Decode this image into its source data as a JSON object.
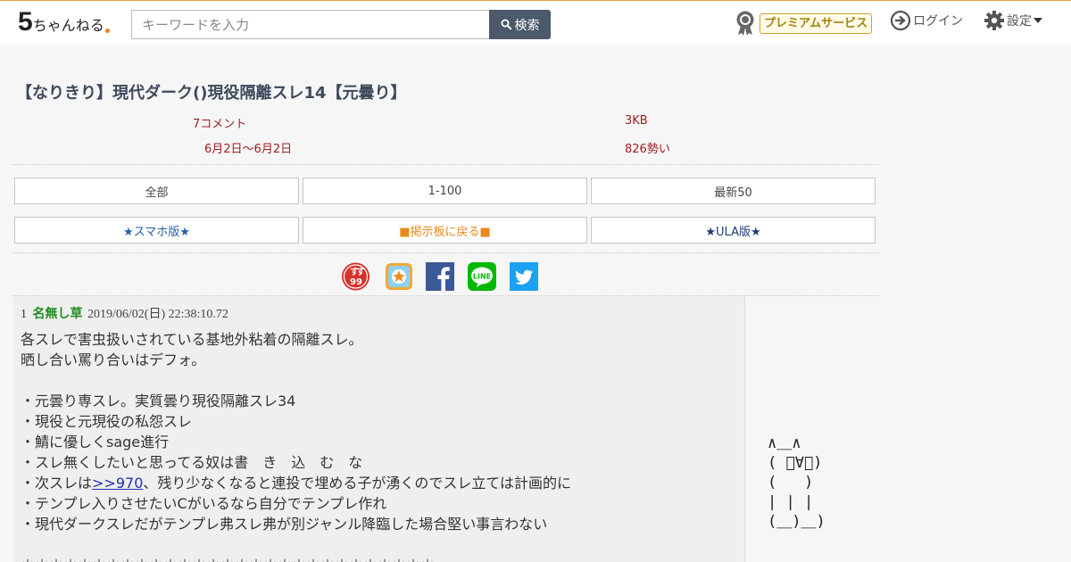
{
  "header": {
    "logo_five": "5",
    "logo_text": "ちゃんねる",
    "search": {
      "placeholder": "キーワードを入力",
      "button_label": "検索"
    },
    "premium_label": "プレミアムサービス",
    "login_label": "ログイン",
    "settings_label": "設定"
  },
  "thread": {
    "title": "【なりきり】現代ダーク()現役隔離スレ14【元曇り】",
    "comments": "7コメント",
    "size": "3KB",
    "date_range": "6月2日〜6月2日",
    "momentum": "826勢い"
  },
  "nav": {
    "all": "全部",
    "range": "1-100",
    "latest": "最新50",
    "smartphone": "★スマホ版★",
    "back_board": "■掲示板に戻る■",
    "ula": "★ULA版★"
  },
  "social": {
    "icons": [
      "sukusuku-icon",
      "app-icon",
      "facebook-icon",
      "line-icon",
      "twitter-icon"
    ],
    "line_label": "LINE"
  },
  "post": {
    "number": "1",
    "name": "名無し草",
    "datetime": "2019/06/02(日) 22:38:10.72",
    "lines": [
      "各スレで害虫扱いされている基地外粘着の隔離スレ。",
      "晒し合い罵り合いはデフォ。",
      "",
      "・元曇り専スレ。実質曇り現役隔離スレ34",
      "・現役と元現役の私怨スレ",
      "・鯖に優しくsage進行",
      "・スレ無くしたいと思ってる奴は書　き　込　む　な"
    ],
    "line_next_prefix": "・次スレは",
    "line_next_link": ">>970",
    "line_next_suffix": "、残り少なくなると連投で埋める子が湧くのでスレ立ては計画的に",
    "lines_after": [
      "・テンプレ入りさせたいCがいるなら自分でテンプレ作れ",
      "・現代ダークスレだがテンプレ弗スレ弗が別ジャンル降臨した場合堅い事言わない",
      "",
      "＊＊＊＊＊＊＊＊＊＊＊＊＊＊＊＊＊＊＊＊＊＊＊＊＊＊＊＊＊"
    ]
  },
  "ascii_art": "∧＿∧\n( ﾟ∀ﾟ)\n(   )\n| | |\n(＿)＿)",
  "colors": {
    "accent_line": "#e8a544",
    "title": "#3e4a5c",
    "meta": "#a01e1e",
    "name": "#228b22",
    "smartphone_link": "#1f5fa6",
    "back_link": "#e88a1a",
    "ula_link": "#1a3a7a"
  }
}
